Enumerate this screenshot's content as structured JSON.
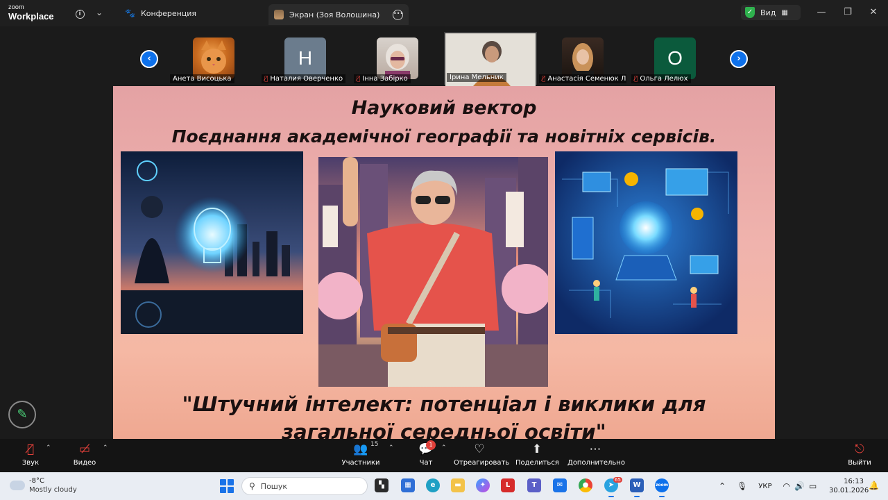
{
  "app": {
    "brand_top": "zoom",
    "brand_bottom": "Workplace"
  },
  "tabs": {
    "conference": "Конференция",
    "screen": "Экран (Зоя Волошина)"
  },
  "header": {
    "view_label": "Вид"
  },
  "participants": [
    {
      "name": "Анета Висоцька",
      "muted": false,
      "kind": "cat"
    },
    {
      "name": "Наталия Оверченко",
      "muted": true,
      "kind": "letter",
      "letter": "Н",
      "color": "#6b7c8d"
    },
    {
      "name": "Інна Забірко",
      "muted": true,
      "kind": "photo"
    },
    {
      "name": "Ірина Мельник",
      "muted": false,
      "kind": "video"
    },
    {
      "name": "Анастасія Семенюк Лі...",
      "muted": true,
      "kind": "photo"
    },
    {
      "name": "Ольга Лелюх",
      "muted": true,
      "kind": "letter",
      "letter": "О",
      "color": "#0b5a3c"
    }
  ],
  "slide": {
    "title_1": "Науковий вектор",
    "title_2": "Поєднання академічної географії та новітніх сервісів.",
    "quote_1": "\"Штучний інтелект: потенціал і виклики для",
    "quote_2": "загальної середньої освіти\""
  },
  "controls": {
    "audio": "Звук",
    "video": "Видео",
    "participants": "Участники",
    "participants_count": "15",
    "chat": "Чат",
    "chat_badge": "1",
    "react": "Отреагировать",
    "share": "Поделиться",
    "more": "Дополнительно",
    "leave": "Выйти"
  },
  "taskbar": {
    "weather_temp": "-8°C",
    "weather_desc": "Mostly cloudy",
    "search_placeholder": "Пошук",
    "language": "УКР",
    "time": "16:13",
    "date": "30.01.2026",
    "telegram_badge": "65"
  },
  "colors": {
    "accent": "#0e71eb",
    "muted": "#e0403a",
    "slide_bg": "#f0b3ad"
  }
}
